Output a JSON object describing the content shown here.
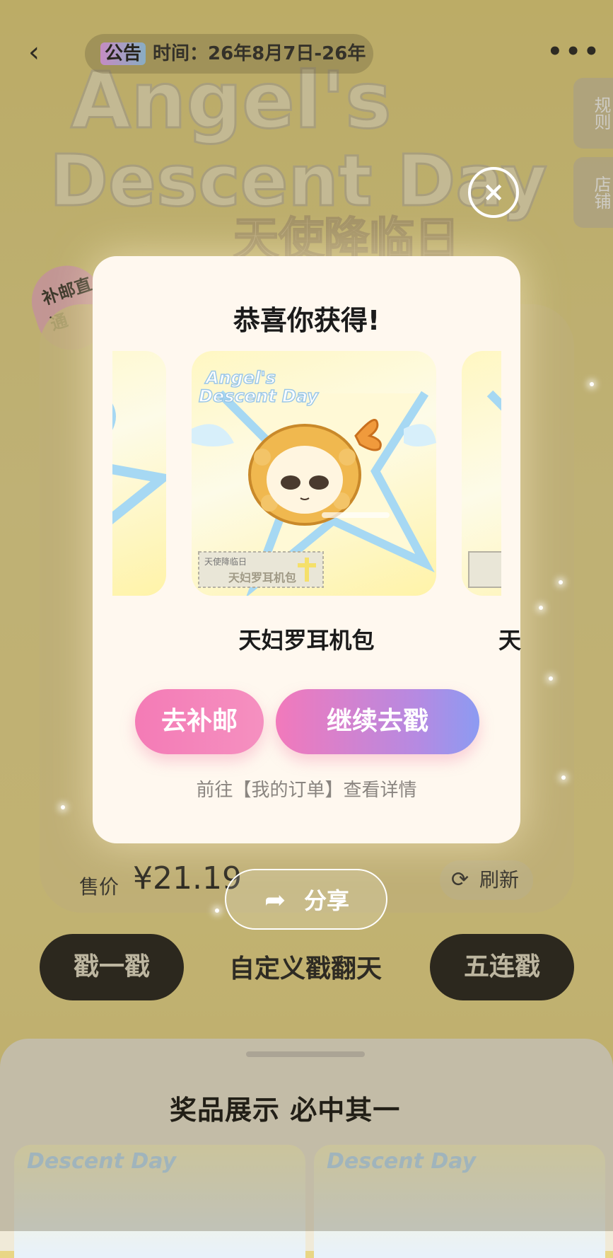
{
  "header": {
    "back_icon": "‹",
    "notice_tag": "公告",
    "notice_text": "时间：26年8月7日-26年",
    "more_icon": "•••"
  },
  "hero": {
    "title_line1": "Angel's",
    "title_line2": "Descent Day",
    "title_cn": "天使降临日"
  },
  "side_tabs": {
    "rules": "规则",
    "shop": "店铺"
  },
  "corner_badge": "补邮直通",
  "product": {
    "price_label": "售价",
    "price_value": "¥21.19",
    "refresh_label": "刷新",
    "refresh_icon": "⟳"
  },
  "share": {
    "label": "分享",
    "icon": "share-arrow"
  },
  "actions": {
    "draw_one": "戳一戳",
    "draw_custom": "自定义戳翻天",
    "draw_five": "五连戳"
  },
  "prize_panel": {
    "title": "奖品展示 必中其一",
    "thumb_text": "Descent Day"
  },
  "modal": {
    "title": "恭喜你获得!",
    "card_brand_line1": "Angel's",
    "card_brand_line2": "Descent Day",
    "card_tag_small": "天使降临日",
    "card_tag_name": "天妇罗耳机包",
    "prize_name": "天妇罗耳机包",
    "prize_name_next": "天",
    "btn_pay_shipping": "去补邮",
    "btn_continue": "继续去戳",
    "order_link": "前往【我的订单】查看详情",
    "close_icon": "×"
  },
  "colors": {
    "background": "#e9d685",
    "modal_bg": "#fff8ef",
    "pink": "#f47bb6",
    "purple": "#8c9bf2",
    "dark_button": "#1f1e1b"
  }
}
